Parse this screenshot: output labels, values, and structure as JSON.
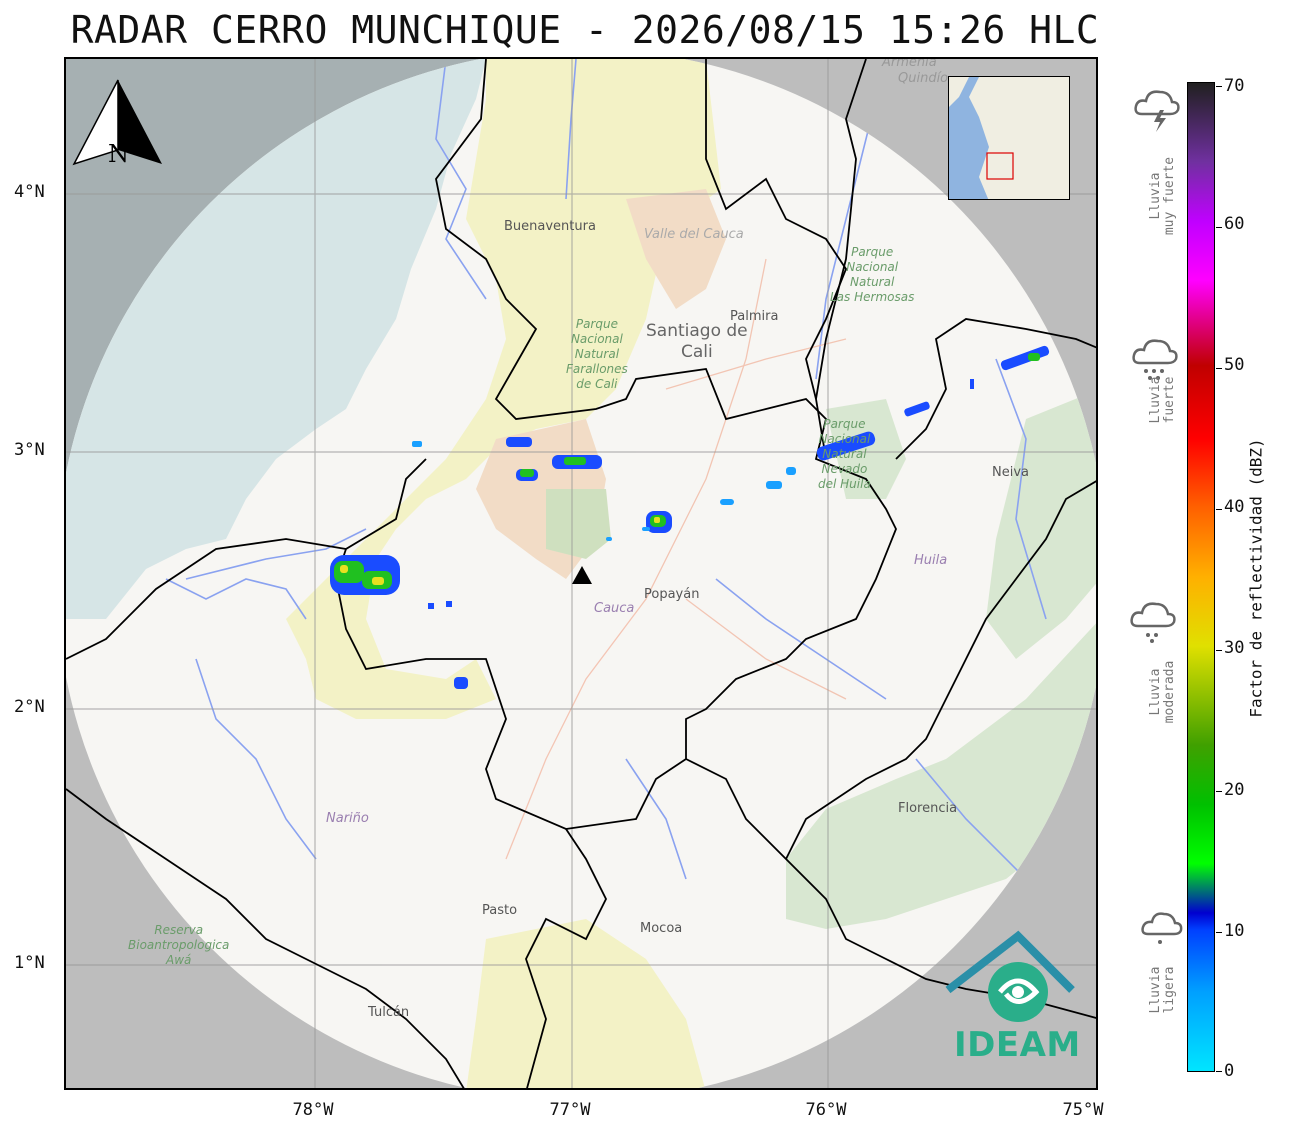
{
  "title": "RADAR CERRO MUNCHIQUE - 2026/08/15 15:26 HLC",
  "axes": {
    "lat_labels": [
      "4°N",
      "3°N",
      "2°N",
      "1°N"
    ],
    "lon_labels": [
      "78°W",
      "77°W",
      "76°W",
      "75°W"
    ]
  },
  "north_arrow": {
    "label": "N"
  },
  "map_labels": {
    "buenaventura": "Buenaventura",
    "valle": "Valle del Cauca",
    "palmira": "Palmira",
    "santiago": "Santiago de\nCali",
    "farallones": "Parque\nNacional\nNatural\nFarallones\nde Cali",
    "hermosas": "Parque\nNacional\nNatural\nLas Hermosas",
    "nevado": "Parque\nNacional\nNatural\nNevado\ndel Huila",
    "neiva": "Neiva",
    "huila": "Huila",
    "cauca": "Cauca",
    "popayan": "Popayán",
    "narino": "Nariño",
    "florencia": "Florencia",
    "pasto": "Pasto",
    "mocoa": "Mocoa",
    "awa": "Reserva\nBioantropologica\nAwá",
    "tulcan": "Tulcán",
    "armenia": "Armenia",
    "quindio": "Quindío"
  },
  "colorbar": {
    "title": "Factor de reflectividad (dBZ)",
    "ticks": [
      "70",
      "60",
      "50",
      "40",
      "30",
      "20",
      "10",
      "0"
    ],
    "min": 0,
    "max": 70
  },
  "intensity_labels": [
    {
      "text": "Lluvia\nmuy fuerte",
      "icon": "thunderstorm-icon"
    },
    {
      "text": "Lluvia\nfuerte",
      "icon": "heavy-rain-icon"
    },
    {
      "text": "Lluvia\nmoderada",
      "icon": "moderate-rain-icon"
    },
    {
      "text": "Lluvia\nligera",
      "icon": "light-rain-icon"
    }
  ],
  "logo": {
    "text": "IDEAM"
  }
}
